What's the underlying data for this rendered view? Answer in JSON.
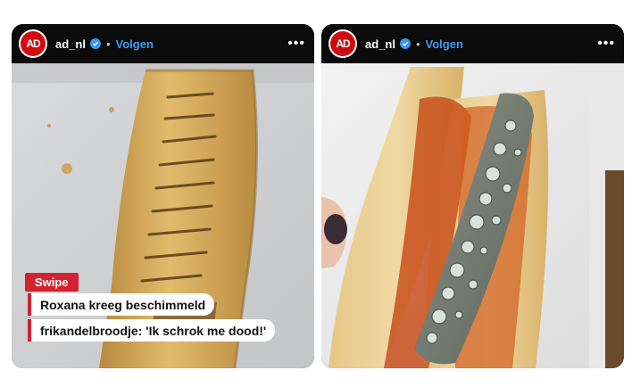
{
  "posts": [
    {
      "logo_text": "AD",
      "handle": "ad_nl",
      "separator": "•",
      "follow_label": "Volgen",
      "more_label": "•••",
      "badge_label": "Swipe",
      "caption_lines": [
        "Roxana kreeg beschimmeld",
        "frikandelbroodje: 'Ik schrok me dood!'"
      ]
    },
    {
      "logo_text": "AD",
      "handle": "ad_nl",
      "separator": "•",
      "follow_label": "Volgen",
      "more_label": "•••"
    }
  ],
  "colors": {
    "brand_red": "#d10a11",
    "verified_blue": "#3897f0",
    "follow_blue": "#3e9bf5",
    "badge_red": "#d32230"
  }
}
